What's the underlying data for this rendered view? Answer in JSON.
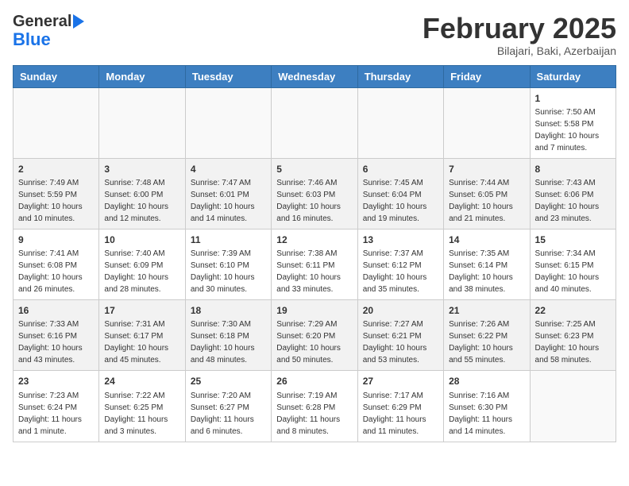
{
  "header": {
    "logo_general": "General",
    "logo_blue": "Blue",
    "title": "February 2025",
    "subtitle": "Bilajari, Baki, Azerbaijan"
  },
  "calendar": {
    "days_of_week": [
      "Sunday",
      "Monday",
      "Tuesday",
      "Wednesday",
      "Thursday",
      "Friday",
      "Saturday"
    ],
    "weeks": [
      [
        {
          "day": "",
          "info": ""
        },
        {
          "day": "",
          "info": ""
        },
        {
          "day": "",
          "info": ""
        },
        {
          "day": "",
          "info": ""
        },
        {
          "day": "",
          "info": ""
        },
        {
          "day": "",
          "info": ""
        },
        {
          "day": "1",
          "info": "Sunrise: 7:50 AM\nSunset: 5:58 PM\nDaylight: 10 hours and 7 minutes."
        }
      ],
      [
        {
          "day": "2",
          "info": "Sunrise: 7:49 AM\nSunset: 5:59 PM\nDaylight: 10 hours and 10 minutes."
        },
        {
          "day": "3",
          "info": "Sunrise: 7:48 AM\nSunset: 6:00 PM\nDaylight: 10 hours and 12 minutes."
        },
        {
          "day": "4",
          "info": "Sunrise: 7:47 AM\nSunset: 6:01 PM\nDaylight: 10 hours and 14 minutes."
        },
        {
          "day": "5",
          "info": "Sunrise: 7:46 AM\nSunset: 6:03 PM\nDaylight: 10 hours and 16 minutes."
        },
        {
          "day": "6",
          "info": "Sunrise: 7:45 AM\nSunset: 6:04 PM\nDaylight: 10 hours and 19 minutes."
        },
        {
          "day": "7",
          "info": "Sunrise: 7:44 AM\nSunset: 6:05 PM\nDaylight: 10 hours and 21 minutes."
        },
        {
          "day": "8",
          "info": "Sunrise: 7:43 AM\nSunset: 6:06 PM\nDaylight: 10 hours and 23 minutes."
        }
      ],
      [
        {
          "day": "9",
          "info": "Sunrise: 7:41 AM\nSunset: 6:08 PM\nDaylight: 10 hours and 26 minutes."
        },
        {
          "day": "10",
          "info": "Sunrise: 7:40 AM\nSunset: 6:09 PM\nDaylight: 10 hours and 28 minutes."
        },
        {
          "day": "11",
          "info": "Sunrise: 7:39 AM\nSunset: 6:10 PM\nDaylight: 10 hours and 30 minutes."
        },
        {
          "day": "12",
          "info": "Sunrise: 7:38 AM\nSunset: 6:11 PM\nDaylight: 10 hours and 33 minutes."
        },
        {
          "day": "13",
          "info": "Sunrise: 7:37 AM\nSunset: 6:12 PM\nDaylight: 10 hours and 35 minutes."
        },
        {
          "day": "14",
          "info": "Sunrise: 7:35 AM\nSunset: 6:14 PM\nDaylight: 10 hours and 38 minutes."
        },
        {
          "day": "15",
          "info": "Sunrise: 7:34 AM\nSunset: 6:15 PM\nDaylight: 10 hours and 40 minutes."
        }
      ],
      [
        {
          "day": "16",
          "info": "Sunrise: 7:33 AM\nSunset: 6:16 PM\nDaylight: 10 hours and 43 minutes."
        },
        {
          "day": "17",
          "info": "Sunrise: 7:31 AM\nSunset: 6:17 PM\nDaylight: 10 hours and 45 minutes."
        },
        {
          "day": "18",
          "info": "Sunrise: 7:30 AM\nSunset: 6:18 PM\nDaylight: 10 hours and 48 minutes."
        },
        {
          "day": "19",
          "info": "Sunrise: 7:29 AM\nSunset: 6:20 PM\nDaylight: 10 hours and 50 minutes."
        },
        {
          "day": "20",
          "info": "Sunrise: 7:27 AM\nSunset: 6:21 PM\nDaylight: 10 hours and 53 minutes."
        },
        {
          "day": "21",
          "info": "Sunrise: 7:26 AM\nSunset: 6:22 PM\nDaylight: 10 hours and 55 minutes."
        },
        {
          "day": "22",
          "info": "Sunrise: 7:25 AM\nSunset: 6:23 PM\nDaylight: 10 hours and 58 minutes."
        }
      ],
      [
        {
          "day": "23",
          "info": "Sunrise: 7:23 AM\nSunset: 6:24 PM\nDaylight: 11 hours and 1 minute."
        },
        {
          "day": "24",
          "info": "Sunrise: 7:22 AM\nSunset: 6:25 PM\nDaylight: 11 hours and 3 minutes."
        },
        {
          "day": "25",
          "info": "Sunrise: 7:20 AM\nSunset: 6:27 PM\nDaylight: 11 hours and 6 minutes."
        },
        {
          "day": "26",
          "info": "Sunrise: 7:19 AM\nSunset: 6:28 PM\nDaylight: 11 hours and 8 minutes."
        },
        {
          "day": "27",
          "info": "Sunrise: 7:17 AM\nSunset: 6:29 PM\nDaylight: 11 hours and 11 minutes."
        },
        {
          "day": "28",
          "info": "Sunrise: 7:16 AM\nSunset: 6:30 PM\nDaylight: 11 hours and 14 minutes."
        },
        {
          "day": "",
          "info": ""
        }
      ]
    ]
  }
}
